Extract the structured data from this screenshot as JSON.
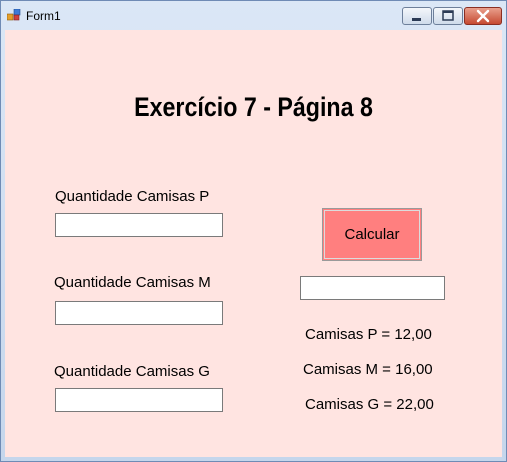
{
  "window": {
    "title": "Form1"
  },
  "heading": "Exercício 7 - Página 8",
  "inputs": [
    {
      "label": "Quantidade Camisas P",
      "value": ""
    },
    {
      "label": "Quantidade Camisas M",
      "value": ""
    },
    {
      "label": "Quantidade Camisas G",
      "value": ""
    }
  ],
  "calculate_button": "Calcular",
  "result_field": {
    "value": ""
  },
  "prices": [
    "Camisas P = 12,00",
    "Camisas M = 16,00",
    "Camisas G = 22,00"
  ],
  "colors": {
    "form_background": "#ffe4e1",
    "button_background": "#ff7f7f"
  }
}
